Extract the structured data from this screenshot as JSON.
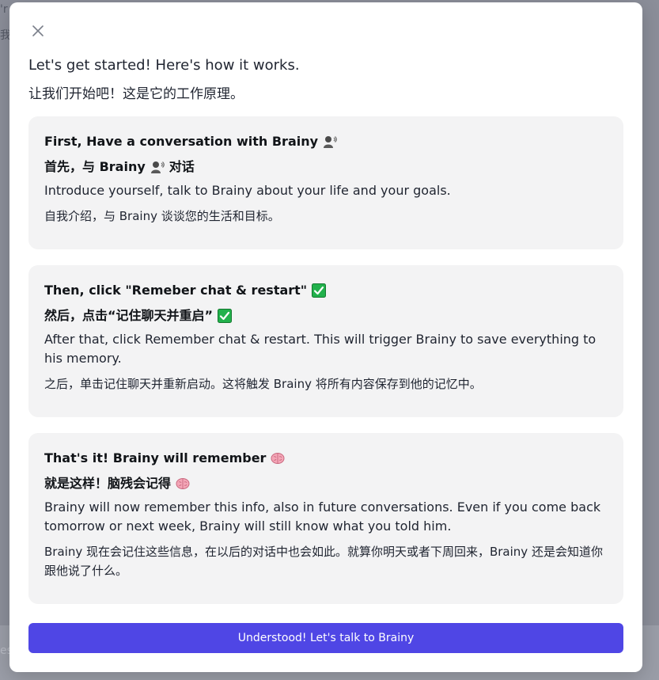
{
  "backdrop": {
    "fragment_top": "'r",
    "fragment_mid": "我",
    "fragment_bottom": "es"
  },
  "modal": {
    "intro_en": "Let's get started! Here's how it works.",
    "intro_zh": "让我们开始吧！这是它的工作原理。",
    "steps": [
      {
        "heading_en": "First, Have a conversation with Brainy",
        "heading_zh_pre": "首先，与 Brainy",
        "heading_zh_post": "对话",
        "icon": "speaking-person-icon",
        "body_en": "Introduce yourself, talk to Brainy about your life and your goals.",
        "body_zh": "自我介绍，与 Brainy 谈谈您的生活和目标。"
      },
      {
        "heading_en": "Then, click \"Remeber chat & restart\"",
        "heading_zh_pre": "然后，点击“记住聊天并重启”",
        "heading_zh_post": "",
        "icon": "check-mark-icon",
        "body_en": "After that, click Remember chat & restart. This will trigger Brainy to save everything to his memory.",
        "body_zh": "之后，单击记住聊天并重新启动。这将触发 Brainy 将所有内容保存到他的记忆中。"
      },
      {
        "heading_en": "That's it! Brainy will remember",
        "heading_zh_pre": "就是这样！脑残会记得",
        "heading_zh_post": "",
        "icon": "brain-icon",
        "body_en": "Brainy will now remember this info, also in future conversations. Even if you come back tomorrow or next week, Brainy will still know what you told him.",
        "body_zh": "Brainy 现在会记住这些信息，在以后的对话中也会如此。就算你明天或者下周回来，Brainy 还是会知道你跟他说了什么。"
      }
    ],
    "cta_label": "Understood! Let's talk to Brainy"
  },
  "colors": {
    "accent": "#4f46e5",
    "card_bg": "#f3f3f4",
    "check_green": "#22b14c",
    "brain_pink": "#f4a6b7"
  }
}
